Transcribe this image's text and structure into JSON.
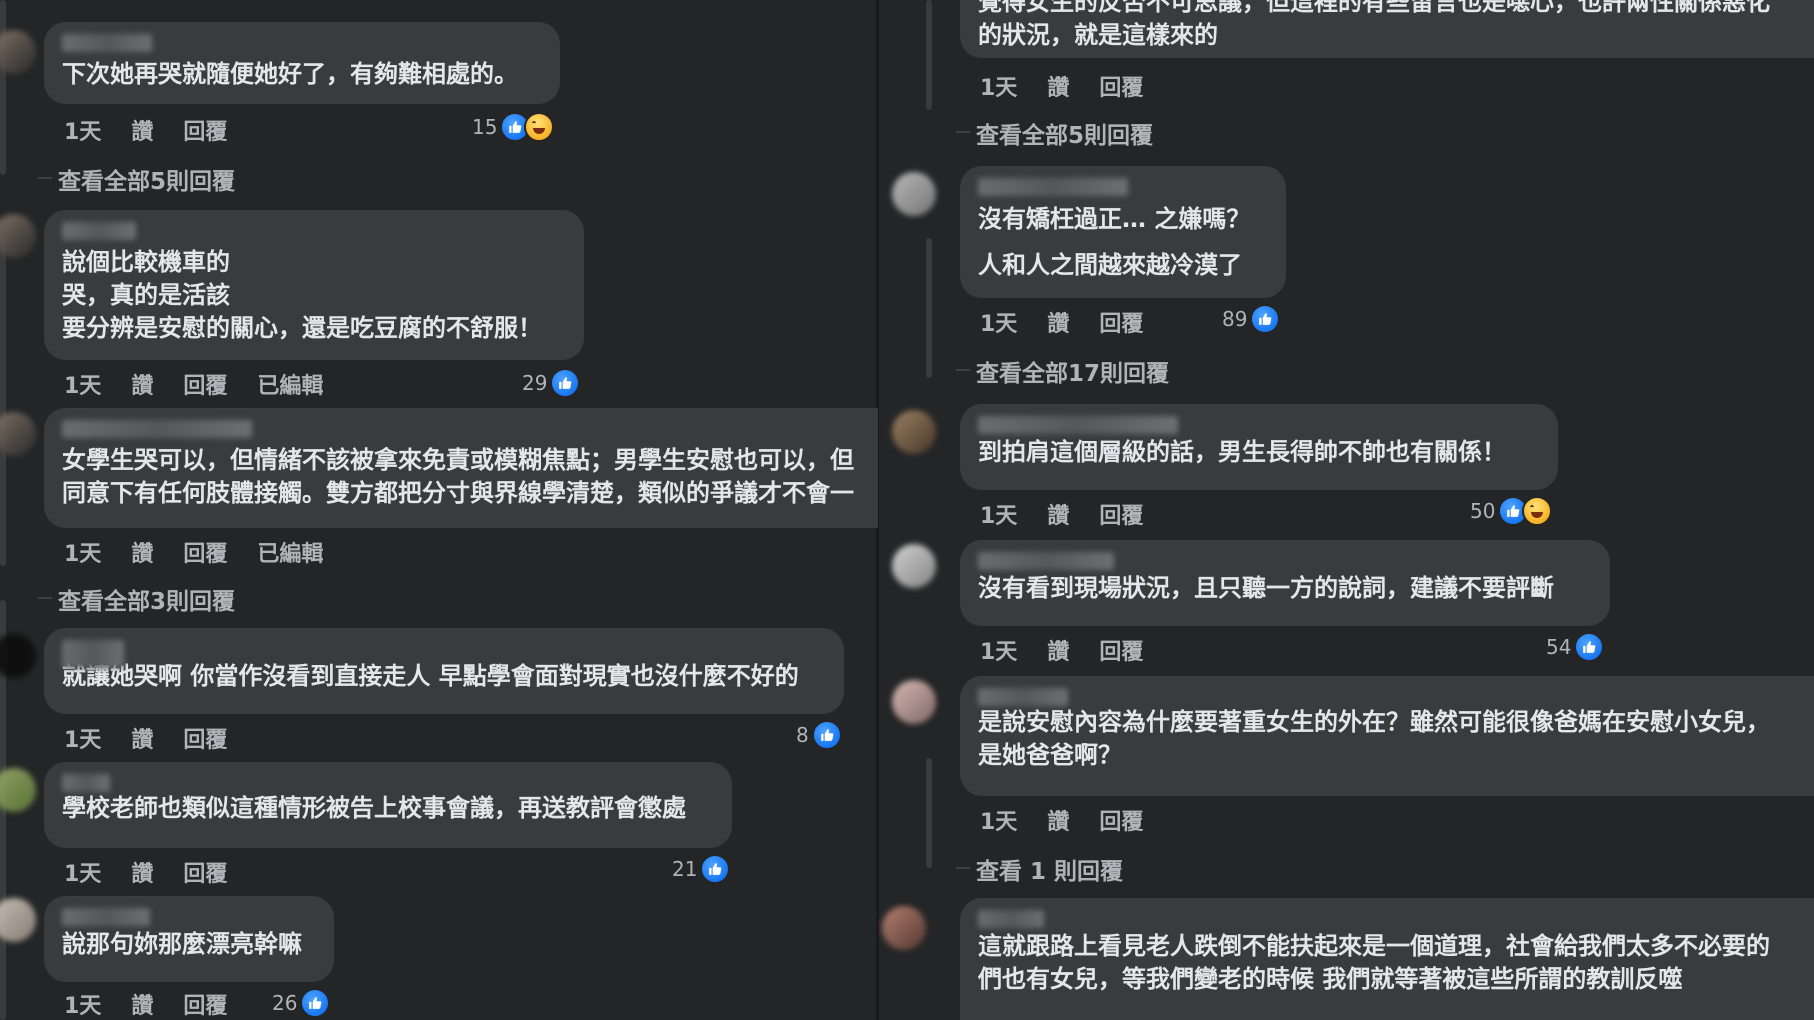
{
  "common": {
    "time": "1天",
    "like": "讚",
    "reply": "回覆",
    "edited": "已編輯"
  },
  "left": {
    "comments": [
      {
        "text": "下次她再哭就隨便她好了，有夠難相處的。",
        "reactions": "15",
        "reaction_icons": [
          "like-icon",
          "haha-icon"
        ]
      },
      {
        "view_replies": "查看全部5則回覆"
      },
      {
        "text": "說個比較機車的\n哭，真的是活該\n要分辨是安慰的關心，還是吃豆腐的不舒服！",
        "reactions": "29",
        "edited": true
      },
      {
        "text": "女學生哭可以，但情緒不該被拿來免責或模糊焦點；男學生安慰也可以，但\n同意下有任何肢體接觸。雙方都把分寸與界線學清楚，類似的爭議才不會一",
        "edited": true
      },
      {
        "view_replies": "查看全部3則回覆"
      },
      {
        "text": "就讓她哭啊 你當作沒看到直接走人 早點學會面對現實也沒什麼不好的",
        "reactions": "8"
      },
      {
        "text": "學校老師也類似這種情形被告上校事會議，再送教評會懲處",
        "reactions": "21"
      },
      {
        "text": "說那句妳那麼漂亮幹嘛",
        "reactions": "26"
      }
    ]
  },
  "right": {
    "comments": [
      {
        "text": "覺得女生的反否不可思議，但這裡的有些留言也是噁心，也許兩性關係惡化\n的狀況，就是這樣來的"
      },
      {
        "view_replies": "查看全部5則回覆"
      },
      {
        "text": "沒有矯枉過正… 之嫌嗎？\n人和人之間越來越冷漠了",
        "reactions": "89"
      },
      {
        "view_replies": "查看全部17則回覆"
      },
      {
        "text": "到拍肩這個層級的話，男生長得帥不帥也有關係！",
        "reactions": "50",
        "reaction_icons": [
          "like-icon",
          "haha-icon"
        ]
      },
      {
        "text": "沒有看到現場狀況，且只聽一方的說詞，建議不要評斷",
        "reactions": "54"
      },
      {
        "text": "是說安慰內容為什麼要著重女生的外在？雖然可能很像爸媽在安慰小女兒，\n是她爸爸啊？"
      },
      {
        "view_replies": "查看 1 則回覆"
      },
      {
        "text": "這就跟路上看見老人跌倒不能扶起來是一個道理，社會給我們太多不必要的\n們也有女兒，等我們變老的時候 我們就等著被這些所謂的教訓反噬"
      }
    ]
  }
}
